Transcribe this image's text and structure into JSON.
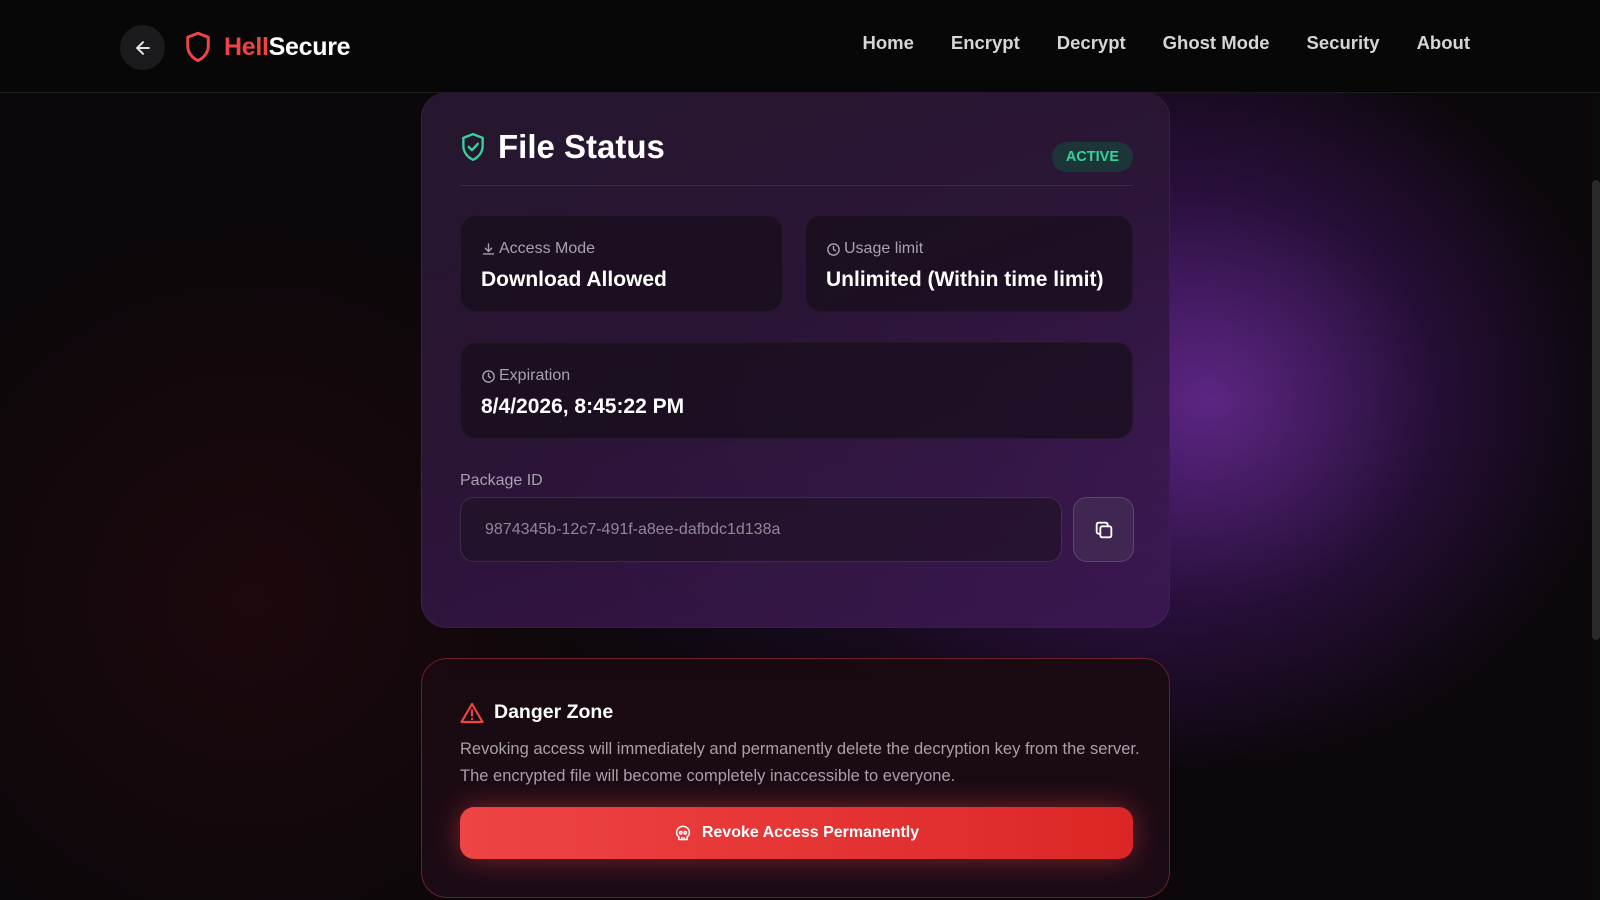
{
  "brand": {
    "part1": "Hell",
    "part2": "Secure",
    "accent": "#ef4444"
  },
  "nav": {
    "items": [
      {
        "label": "Home"
      },
      {
        "label": "Encrypt"
      },
      {
        "label": "Decrypt"
      },
      {
        "label": "Ghost Mode"
      },
      {
        "label": "Security"
      },
      {
        "label": "About"
      }
    ]
  },
  "status": {
    "title": "File Status",
    "badge": "ACTIVE",
    "badge_color": "#34d399",
    "access_mode": {
      "label": "Access Mode",
      "value": "Download Allowed",
      "icon": "download-icon"
    },
    "usage_limit": {
      "label": "Usage limit",
      "value": "Unlimited (Within time limit)",
      "icon": "clock-icon"
    },
    "expiration": {
      "label": "Expiration",
      "value": "8/4/2026, 8:45:22 PM",
      "icon": "clock-icon"
    },
    "package": {
      "label": "Package ID",
      "value": "9874345b-12c7-491f-a8ee-dafbdc1d138a"
    }
  },
  "danger": {
    "title": "Danger Zone",
    "description": "Revoking access will immediately and permanently delete the decryption key from the server. The encrypted file will become completely inaccessible to everyone.",
    "button_label": "Revoke Access Permanently",
    "color": "#ef4444"
  }
}
